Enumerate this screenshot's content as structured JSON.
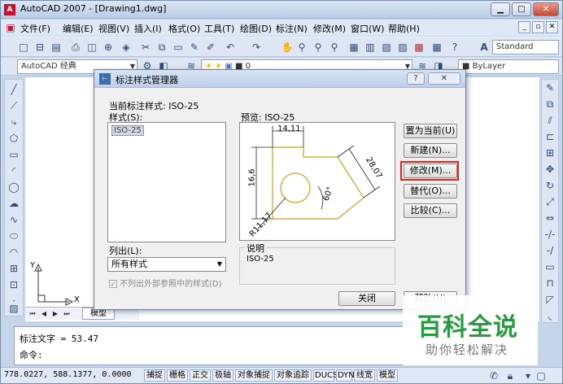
{
  "window": {
    "title": "AutoCAD 2007 - [Drawing1.dwg]",
    "logo": "A"
  },
  "menu": [
    "文件(F)",
    "编辑(E)",
    "视图(V)",
    "插入(I)",
    "格式(O)",
    "工具(T)",
    "绘图(D)",
    "标注(N)",
    "修改(M)",
    "窗口(W)",
    "帮助(H)"
  ],
  "toolbar": {
    "text_style_value": "Standard",
    "workspace_value": "AutoCAD 经典",
    "layer_value": "0",
    "color_value": "ByLayer"
  },
  "dialog": {
    "title": "标注样式管理器",
    "current_style_label": "当前标注样式: ISO-25",
    "styles_label": "样式(S):",
    "styles": [
      "ISO-25"
    ],
    "preview_label": "预览: ISO-25",
    "preview_dims": {
      "top": "14,11",
      "left": "16,6",
      "diag": "28,07",
      "angle": "60°",
      "radius": "R11,17"
    },
    "buttons": {
      "set_current": "置为当前(U)",
      "new": "新建(N)...",
      "modify": "修改(M)...",
      "override": "替代(O)...",
      "compare": "比较(C)..."
    },
    "list_label": "列出(L):",
    "list_value": "所有样式",
    "exclude_xref_label": "不列出外部参照中的样式(D)",
    "description_label": "说明",
    "description_value": "ISO-25",
    "close_label": "关闭",
    "help_label": "帮助(H)",
    "title_help": "?"
  },
  "ucs": {
    "x": "X",
    "y": "Y"
  },
  "layout_tab": "模型",
  "command": {
    "line1": "标注文字 = 53.47",
    "line2": "命令:"
  },
  "status": {
    "coords": "778.0227, 588.1377, 0.0000",
    "buttons": [
      "捕捉",
      "栅格",
      "正交",
      "极轴",
      "对象捕捉",
      "对象追踪",
      "DUCS",
      "DYN",
      "线宽",
      "模型"
    ]
  },
  "watermark": {
    "main": "百科全说",
    "sub": "助你轻松解决"
  },
  "colors": {
    "highlight": "#d9261c",
    "watermark_green": "#2a9a3e",
    "preview_line": "#c8a21a"
  }
}
